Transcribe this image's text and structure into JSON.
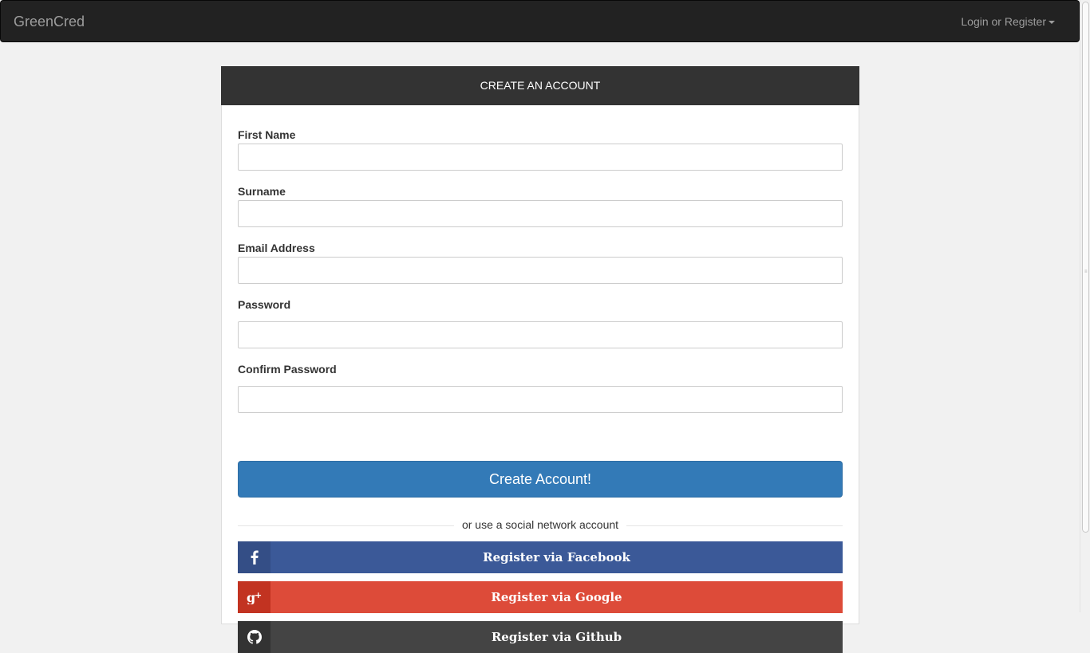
{
  "navbar": {
    "brand": "GreenCred",
    "menu_label": "Login or Register"
  },
  "form": {
    "heading": "CREATE AN ACCOUNT",
    "fields": [
      {
        "label": "First Name",
        "value": ""
      },
      {
        "label": "Surname",
        "value": ""
      },
      {
        "label": "Email Address",
        "value": ""
      },
      {
        "label": "Password",
        "value": ""
      },
      {
        "label": "Confirm Password",
        "value": ""
      }
    ],
    "submit_label": "Create Account!",
    "divider_text": "or use a social network account"
  },
  "social": {
    "facebook": {
      "label": "Register via Facebook",
      "icon": "facebook-icon",
      "color": "#3b5998"
    },
    "google": {
      "label": "Register via Google",
      "icon": "google-plus-icon",
      "color": "#dd4b39"
    },
    "github": {
      "label": "Register via Github",
      "icon": "github-icon",
      "color": "#444444"
    }
  },
  "colors": {
    "navbar": "#222222",
    "primary": "#337ab7",
    "panel_heading": "#333333"
  }
}
